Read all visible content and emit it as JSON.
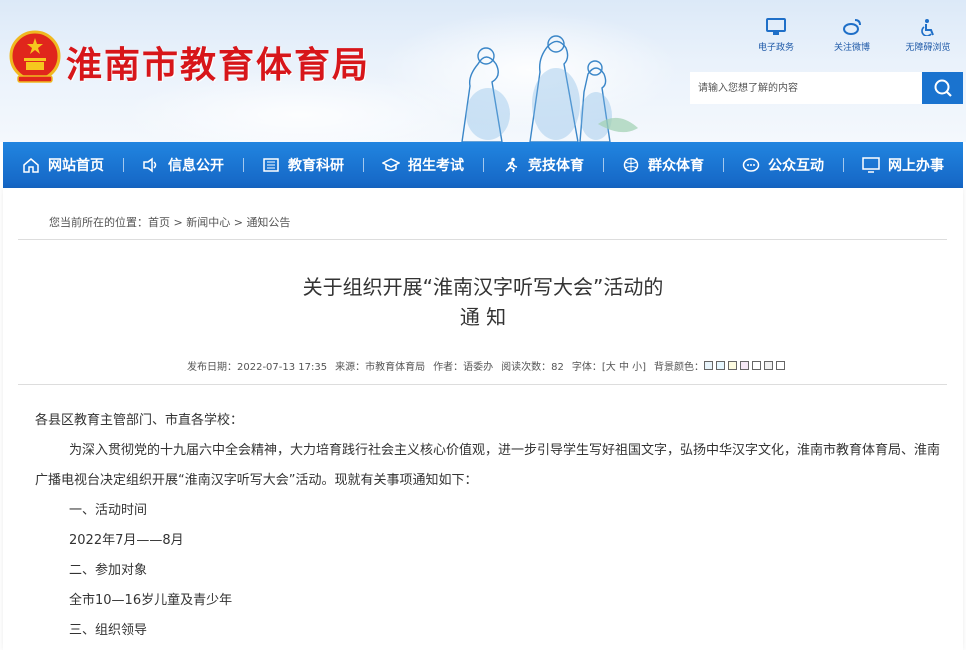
{
  "site": {
    "title": "淮南市教育体育局"
  },
  "quick_links": [
    {
      "label": "电子政务",
      "icon": "monitor-icon"
    },
    {
      "label": "关注微博",
      "icon": "weibo-icon"
    },
    {
      "label": "无障碍浏览",
      "icon": "accessibility-icon"
    }
  ],
  "search": {
    "placeholder": "请输入您想了解的内容"
  },
  "nav": [
    {
      "label": "网站首页",
      "icon": "home-icon"
    },
    {
      "label": "信息公开",
      "icon": "speaker-icon"
    },
    {
      "label": "教育科研",
      "icon": "book-icon"
    },
    {
      "label": "招生考试",
      "icon": "graduation-cap-icon"
    },
    {
      "label": "竞技体育",
      "icon": "runner-icon"
    },
    {
      "label": "群众体育",
      "icon": "ball-icon"
    },
    {
      "label": "公众互动",
      "icon": "chat-icon"
    },
    {
      "label": "网上办事",
      "icon": "desktop-icon"
    }
  ],
  "breadcrumb": {
    "prefix": "您当前所在的位置：",
    "items": [
      "首页",
      "新闻中心",
      "通知公告"
    ],
    "separator": ">"
  },
  "article": {
    "title_line1": "关于组织开展“淮南汉字听写大会”活动的",
    "title_line2": "通 知",
    "meta": {
      "date": "发布日期：2022-07-13 17:35",
      "source": "来源：市教育体育局",
      "author": "作者：语委办",
      "views": "阅读次数：82",
      "font": "字体：[大 中 小]",
      "bg_label": "背景颜色："
    },
    "bg_colors": [
      "#e8f4fb",
      "#e6f7ff",
      "#fdfbe0",
      "#f5e8f5",
      "#ffffff",
      "#f0f0f0",
      "#ffffff"
    ],
    "paragraphs": [
      "各县区教育主管部门、市直各学校：",
      "为深入贯彻党的十九届六中全会精神，大力培育践行社会主义核心价值观，进一步引导学生写好祖国文字，弘扬中华汉字文化，淮南市教育体育局、淮南广播电视台决定组织开展“淮南汉字听写大会”活动。现就有关事项通知如下：",
      "一、活动时间",
      "2022年7月——8月",
      "二、参加对象",
      "全市10—16岁儿童及青少年",
      "三、组织领导"
    ]
  },
  "colors": {
    "brand_red": "#d7161a",
    "nav_blue": "#1a73cf"
  }
}
